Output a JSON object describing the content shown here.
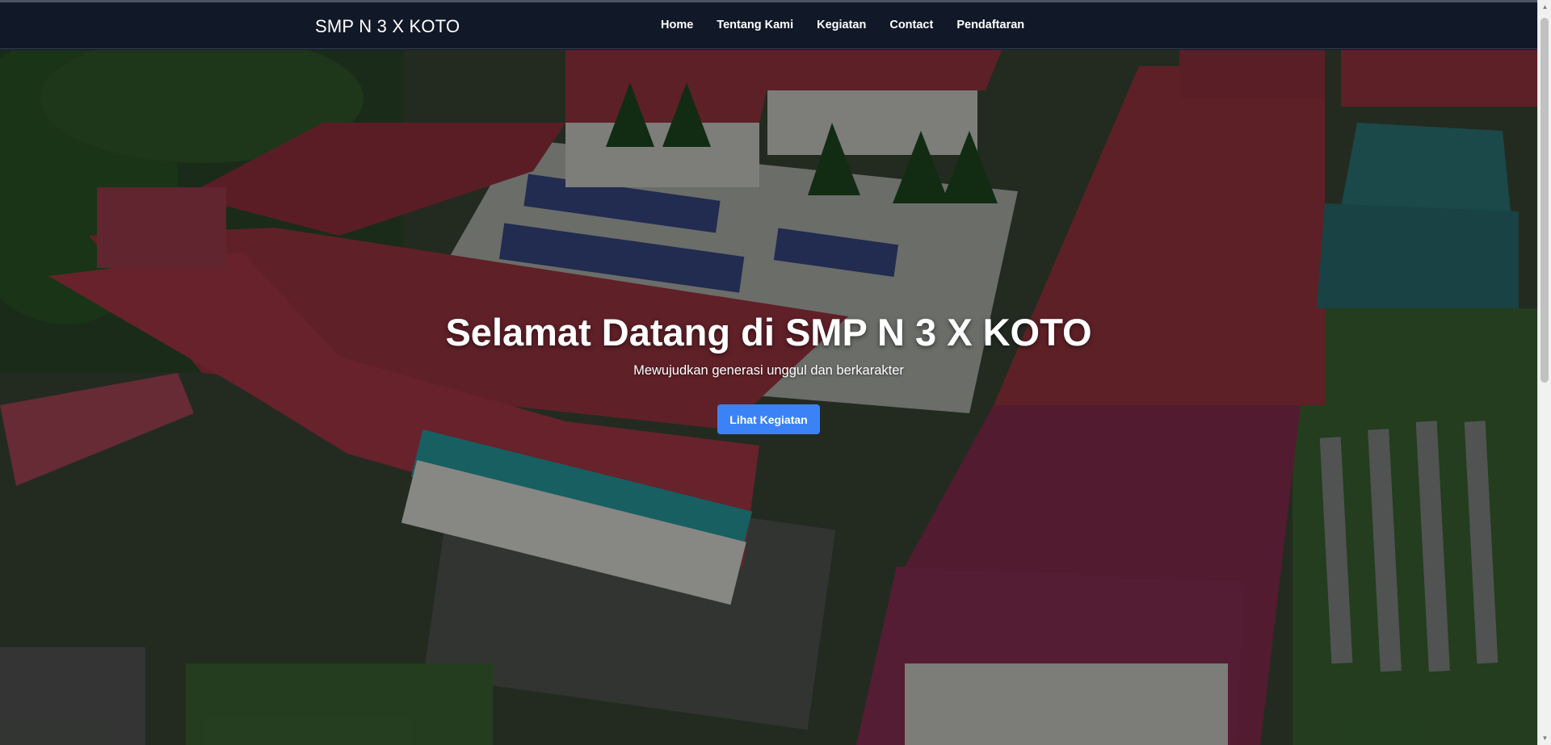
{
  "navbar": {
    "brand": "SMP N 3 X KOTO",
    "links": [
      {
        "label": "Home"
      },
      {
        "label": "Tentang Kami"
      },
      {
        "label": "Kegiatan"
      },
      {
        "label": "Contact"
      },
      {
        "label": "Pendaftaran"
      }
    ]
  },
  "hero": {
    "title": "Selamat Datang di SMP N 3 X KOTO",
    "subtitle": "Mewujudkan generasi unggul dan berkarakter",
    "button_label": "Lihat Kegiatan",
    "background_image": "aerial photo of school buildings with red roofs and courtyard"
  },
  "colors": {
    "navbar_bg": "#111827",
    "button_bg": "#3b82f6",
    "roof_red": "#b23a48",
    "roof_teal": "#2f8a8a"
  }
}
